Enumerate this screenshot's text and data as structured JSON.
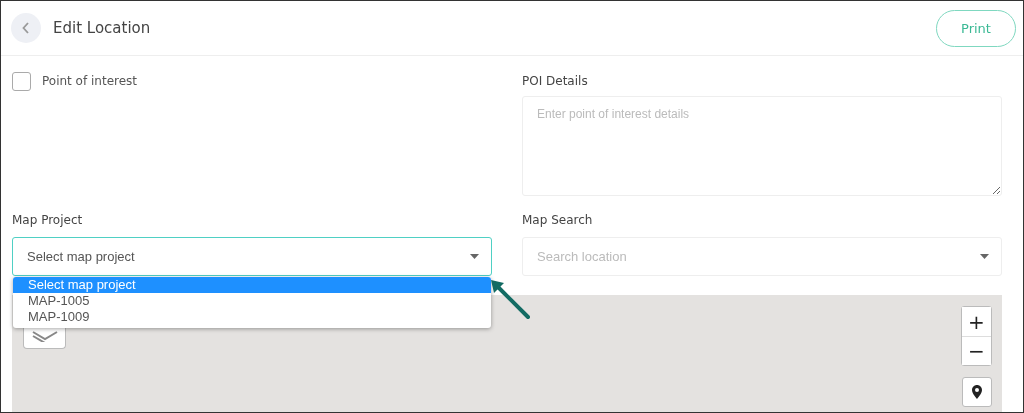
{
  "header": {
    "title": "Edit Location",
    "print_button": "Print"
  },
  "poi": {
    "label": "Point of interest",
    "checked": false
  },
  "poi_details": {
    "label": "POI Details",
    "placeholder": "Enter point of interest details"
  },
  "map_project": {
    "label": "Map Project",
    "value": "Select map project",
    "expanded": true,
    "options": [
      {
        "label": "Select map project",
        "selected": true
      },
      {
        "label": "MAP-1005",
        "selected": false
      },
      {
        "label": "MAP-1009",
        "selected": false
      }
    ]
  },
  "map_search": {
    "label": "Map Search",
    "placeholder": "Search location"
  },
  "map": {
    "zoom_in": "+",
    "zoom_out": "−"
  }
}
